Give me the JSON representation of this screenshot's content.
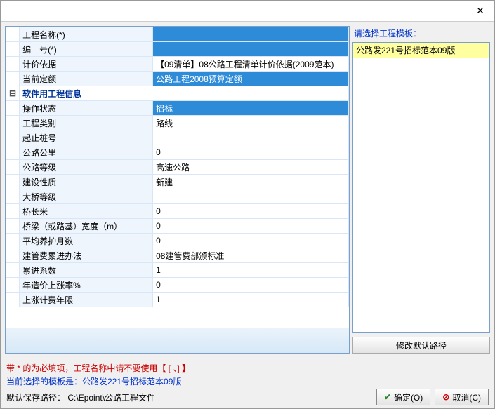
{
  "titlebar": {
    "close": "✕"
  },
  "grid": {
    "rows": [
      {
        "label": "工程名称(*)",
        "value": "",
        "hlValue": true
      },
      {
        "label": "编　号(*)",
        "value": "",
        "hlValue": true
      },
      {
        "label": "计价依据",
        "value": "【09清单】08公路工程清单计价依据(2009范本)"
      },
      {
        "label": "当前定额",
        "value": "公路工程2008预算定额",
        "hlValue": true
      }
    ],
    "section": {
      "expander": "⊟",
      "label": "软件用工程信息"
    },
    "rows2": [
      {
        "label": "操作状态",
        "value": "招标",
        "hlValue": true
      },
      {
        "label": "工程类别",
        "value": "路线"
      },
      {
        "label": "起止桩号",
        "value": ""
      },
      {
        "label": "公路公里",
        "value": "0"
      },
      {
        "label": "公路等级",
        "value": "高速公路"
      },
      {
        "label": "建设性质",
        "value": "新建"
      },
      {
        "label": "大桥等级",
        "value": ""
      },
      {
        "label": "桥长米",
        "value": "0"
      },
      {
        "label": "桥梁（或路基）宽度（m）",
        "value": "0"
      },
      {
        "label": "平均养护月数",
        "value": "0"
      },
      {
        "label": "建管费累进办法",
        "value": "08建管费部颁标准"
      },
      {
        "label": "累进系数",
        "value": "1"
      },
      {
        "label": "年造价上涨率%",
        "value": "0"
      },
      {
        "label": "上涨计费年限",
        "value": "1"
      }
    ]
  },
  "right": {
    "label": "请选择工程模板：",
    "items": [
      "公路发221号招标范本09版"
    ],
    "pathBtn": "修改默认路径"
  },
  "footer": {
    "mandatory": "带 * 的为必填项，工程名称中请不要使用【 [ 、] 】",
    "currentTpl": "当前选择的模板是：公路发221号招标范本09版",
    "pathLabel": "默认保存路径：",
    "pathValue": "C:\\Epoint\\公路工程文件",
    "ok": "确定(O)",
    "cancel": "取消(C)"
  }
}
